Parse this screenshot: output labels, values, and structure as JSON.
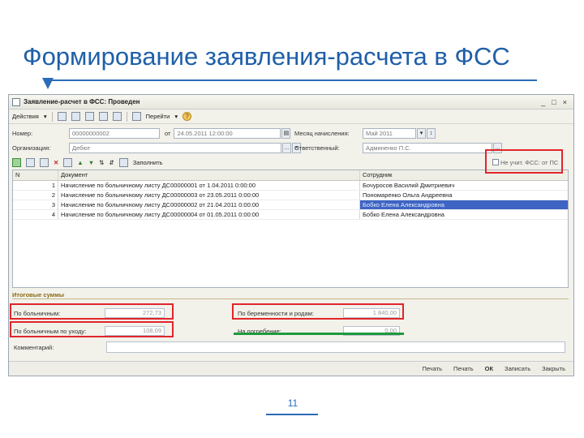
{
  "slide": {
    "title": "Формирование заявления-расчета в ФСС",
    "page_number": "11"
  },
  "window": {
    "title": "Заявление-расчет в ФСС: Проведен",
    "controls": [
      "_",
      "□",
      "×"
    ]
  },
  "toolbar": {
    "actions_label": "Действия",
    "goto_label": "Перейти",
    "help_glyph": "?"
  },
  "form": {
    "number_label": "Номер:",
    "number_value": "00000000002",
    "date_sep": "от",
    "date_value": "24.05.2011 12:00:00",
    "month_label": "Месяц начисления:",
    "month_value": "Май 2011",
    "org_label": "Организация:",
    "org_value": "Дебют",
    "resp_label": "Ответственный:",
    "resp_value": "Админенко П.С.",
    "fss_checkbox_label": "Не учит. ФСС: от ПС"
  },
  "table_toolbar": {
    "fill_label": "Заполнить"
  },
  "table": {
    "columns": [
      "N",
      "Документ",
      "Сотрудник"
    ],
    "rows": [
      {
        "n": "1",
        "doc": "Начисление по больничному листу ДС00000001 от 1.04.2011 0:00:00",
        "emp": "Бочуросов Василий Дмитриевич"
      },
      {
        "n": "2",
        "doc": "Начисление по больничному листу ДС00000003 от 23.05.2011 0:00:00",
        "emp": "Пономаренко Ольга Андреевна"
      },
      {
        "n": "3",
        "doc": "Начисление по больничному листу ДС00000002 от 21.04.2011 0:00:00",
        "emp": "Бобко Елена Александровна"
      },
      {
        "n": "4",
        "doc": "Начисление по больничному листу ДС00000004 от 01.05.2011 0:00:00",
        "emp": "Бобко Елена Александровна"
      }
    ],
    "selected_row": 3
  },
  "totals": {
    "section_label": "Итоговые суммы",
    "sick_label": "По больничным:",
    "sick_value": "272,73",
    "care_label": "По больничным по уходу:",
    "care_value": "108,09",
    "maternity_label": "По беременности и родам:",
    "maternity_value": "1 840,00",
    "burial_label": "На погребение:",
    "burial_value": "0,00"
  },
  "comment": {
    "label": "Комментарий:",
    "value": ""
  },
  "bottom": {
    "buttons": [
      "Печать",
      "Печать",
      "ОК",
      "Записать",
      "Закрыть"
    ]
  },
  "colors": {
    "highlight": "#e0262b",
    "underline": "#1e9a3d",
    "accent": "#1f5fa8"
  }
}
